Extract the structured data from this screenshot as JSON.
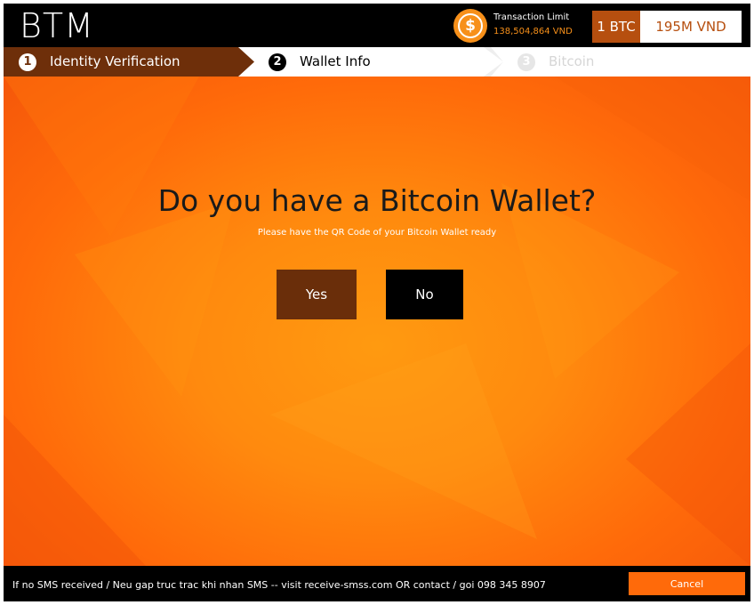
{
  "header": {
    "logo": "BTM",
    "coin_icon": "dollar-coin-icon",
    "coin_symbol": "$",
    "limit_label": "Transaction Limit",
    "limit_value": "138,504,864 VND",
    "rate_btc": "1 BTC",
    "rate_vnd": "195M VND"
  },
  "steps": [
    {
      "number": "1",
      "label": "Identity Verification",
      "state": "completed"
    },
    {
      "number": "2",
      "label": "Wallet Info",
      "state": "active"
    },
    {
      "number": "3",
      "label": "Bitcoin",
      "state": "upcoming"
    }
  ],
  "main": {
    "question": "Do you have a Bitcoin Wallet?",
    "subtitle": "Please have the QR Code of your Bitcoin Wallet ready",
    "yes_label": "Yes",
    "no_label": "No"
  },
  "footer": {
    "message": "If no SMS received / Neu gap truc trac khi nhan SMS -- visit receive-smss.com OR contact / goi 098 345 8907",
    "cancel_label": "Cancel"
  },
  "colors": {
    "accent_orange": "#f7901a",
    "main_orange": "#ff8a0e",
    "dark_brown": "#6a2e0a",
    "rate_brown": "#b64f0f",
    "cancel_orange": "#ff6a0a"
  }
}
